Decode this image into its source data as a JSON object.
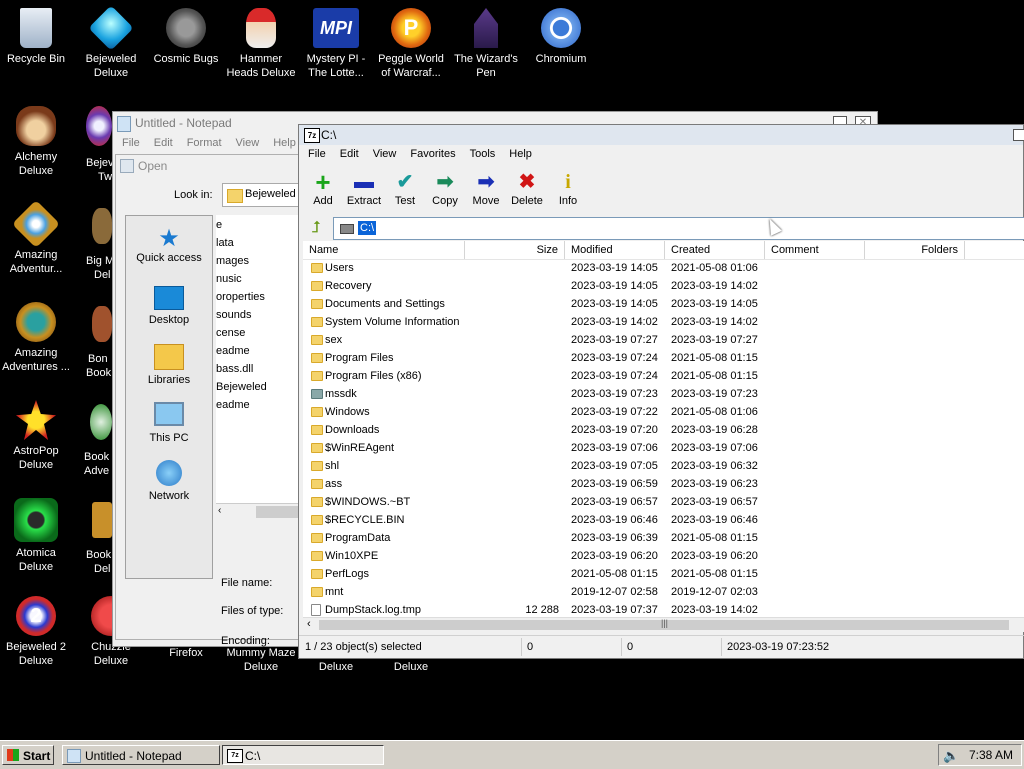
{
  "desktop": {
    "icons": [
      {
        "label": "Recycle Bin",
        "icon": "recycle-bin-icon"
      },
      {
        "label": "Bejeweled Deluxe",
        "icon": "bejeweled-icon"
      },
      {
        "label": "Cosmic Bugs",
        "icon": "cosmic-bugs-icon"
      },
      {
        "label": "Hammer Heads Deluxe",
        "icon": "hammer-heads-icon"
      },
      {
        "label": "Mystery PI - The Lotte...",
        "icon": "mystery-pi-icon"
      },
      {
        "label": "Peggle World of Warcraf...",
        "icon": "peggle-icon"
      },
      {
        "label": "The Wizard's Pen",
        "icon": "wizards-pen-icon"
      },
      {
        "label": "Chromium",
        "icon": "chromium-icon"
      },
      {
        "label": "Alchemy Deluxe",
        "icon": "alchemy-icon"
      },
      {
        "label": "Amazing Adventur...",
        "icon": "amazing-adventures-icon"
      },
      {
        "label": "Amazing Adventures ...",
        "icon": "amazing-adventures-2-icon"
      },
      {
        "label": "AstroPop Deluxe",
        "icon": "astropop-icon"
      },
      {
        "label": "Atomica Deluxe",
        "icon": "atomica-icon"
      },
      {
        "label": "Bejeweled 2 Deluxe",
        "icon": "bejeweled-2-icon"
      },
      {
        "label": "Chuzzle Deluxe",
        "icon": "chuzzle-icon"
      },
      {
        "label": "Firefox",
        "icon": "firefox-icon"
      },
      {
        "label": "Mummy Maze Deluxe",
        "icon": "mummy-maze-icon"
      },
      {
        "label": "Deluxe",
        "icon": "generic-game-icon"
      },
      {
        "label": "Deluxe",
        "icon": "generic-game-2-icon"
      }
    ],
    "partial_labels": [
      "Bejev",
      "Tw",
      "Big M",
      "Del",
      "Bon",
      "Book",
      "Book",
      "Adve",
      "Book",
      "Del"
    ]
  },
  "notepad": {
    "title": "Untitled - Notepad",
    "menu": [
      "File",
      "Edit",
      "Format",
      "View",
      "Help"
    ]
  },
  "open_dialog": {
    "title": "Open",
    "look_in_label": "Look in:",
    "look_in_value": "Bejeweled",
    "places": [
      "Quick access",
      "Desktop",
      "Libraries",
      "This PC",
      "Network"
    ],
    "files": [
      "e",
      "lata",
      "mages",
      "nusic",
      "oroperties",
      "sounds",
      "cense",
      "eadme",
      "bass.dll",
      "Bejeweled",
      "eadme"
    ],
    "file_name_label": "File name:",
    "files_of_type_label": "Files of type:",
    "encoding_label": "Encoding:"
  },
  "sevenzip": {
    "title": "C:\\",
    "app_badge": "7z",
    "menu": [
      "File",
      "Edit",
      "View",
      "Favorites",
      "Tools",
      "Help"
    ],
    "toolbar": [
      {
        "label": "Add",
        "icon": "add-icon",
        "glyph": "+",
        "color": "#1aa51a"
      },
      {
        "label": "Extract",
        "icon": "extract-icon",
        "glyph": "▬",
        "color": "#1a2fb5"
      },
      {
        "label": "Test",
        "icon": "test-icon",
        "glyph": "✔",
        "color": "#1a9a9a"
      },
      {
        "label": "Copy",
        "icon": "copy-icon",
        "glyph": "➡",
        "color": "#1a8a5a"
      },
      {
        "label": "Move",
        "icon": "move-icon",
        "glyph": "➡",
        "color": "#1a2fb5"
      },
      {
        "label": "Delete",
        "icon": "delete-icon",
        "glyph": "✖",
        "color": "#d01515"
      },
      {
        "label": "Info",
        "icon": "info-icon",
        "glyph": "i",
        "color": "#c8a800"
      }
    ],
    "address": "C:\\",
    "columns": [
      "Name",
      "Size",
      "Modified",
      "Created",
      "Comment",
      "Folders"
    ],
    "rows": [
      {
        "name": "Users",
        "size": "",
        "modified": "2023-03-19 14:05",
        "created": "2021-05-08 01:06",
        "type": "folder"
      },
      {
        "name": "Recovery",
        "size": "",
        "modified": "2023-03-19 14:05",
        "created": "2023-03-19 14:02",
        "type": "folder"
      },
      {
        "name": "Documents and Settings",
        "size": "",
        "modified": "2023-03-19 14:05",
        "created": "2023-03-19 14:05",
        "type": "folder"
      },
      {
        "name": "System Volume Information",
        "size": "",
        "modified": "2023-03-19 14:02",
        "created": "2023-03-19 14:02",
        "type": "folder"
      },
      {
        "name": "sex",
        "size": "",
        "modified": "2023-03-19 07:27",
        "created": "2023-03-19 07:27",
        "type": "folder"
      },
      {
        "name": "Program Files",
        "size": "",
        "modified": "2023-03-19 07:24",
        "created": "2021-05-08 01:15",
        "type": "folder"
      },
      {
        "name": "Program Files (x86)",
        "size": "",
        "modified": "2023-03-19 07:24",
        "created": "2021-05-08 01:15",
        "type": "folder"
      },
      {
        "name": "mssdk",
        "size": "",
        "modified": "2023-03-19 07:23",
        "created": "2023-03-19 07:23",
        "type": "selected"
      },
      {
        "name": "Windows",
        "size": "",
        "modified": "2023-03-19 07:22",
        "created": "2021-05-08 01:06",
        "type": "folder"
      },
      {
        "name": "Downloads",
        "size": "",
        "modified": "2023-03-19 07:20",
        "created": "2023-03-19 06:28",
        "type": "folder"
      },
      {
        "name": "$WinREAgent",
        "size": "",
        "modified": "2023-03-19 07:06",
        "created": "2023-03-19 07:06",
        "type": "folder"
      },
      {
        "name": "shl",
        "size": "",
        "modified": "2023-03-19 07:05",
        "created": "2023-03-19 06:32",
        "type": "folder"
      },
      {
        "name": "ass",
        "size": "",
        "modified": "2023-03-19 06:59",
        "created": "2023-03-19 06:23",
        "type": "folder"
      },
      {
        "name": "$WINDOWS.~BT",
        "size": "",
        "modified": "2023-03-19 06:57",
        "created": "2023-03-19 06:57",
        "type": "folder"
      },
      {
        "name": "$RECYCLE.BIN",
        "size": "",
        "modified": "2023-03-19 06:46",
        "created": "2023-03-19 06:46",
        "type": "folder"
      },
      {
        "name": "ProgramData",
        "size": "",
        "modified": "2023-03-19 06:39",
        "created": "2021-05-08 01:15",
        "type": "folder"
      },
      {
        "name": "Win10XPE",
        "size": "",
        "modified": "2023-03-19 06:20",
        "created": "2023-03-19 06:20",
        "type": "folder"
      },
      {
        "name": "PerfLogs",
        "size": "",
        "modified": "2021-05-08 01:15",
        "created": "2021-05-08 01:15",
        "type": "folder"
      },
      {
        "name": "mnt",
        "size": "",
        "modified": "2019-12-07 02:58",
        "created": "2019-12-07 02:03",
        "type": "folder"
      },
      {
        "name": "DumpStack.log.tmp",
        "size": "12 288",
        "modified": "2023-03-19 07:37",
        "created": "2023-03-19 14:02",
        "type": "file"
      }
    ],
    "status": {
      "selected": "1 / 23 object(s) selected",
      "size": "0",
      "packed": "0",
      "date": "2023-03-19 07:23:52"
    }
  },
  "taskbar": {
    "start_label": "Start",
    "tasks": [
      {
        "label": "Untitled - Notepad",
        "icon": "notepad-icon"
      },
      {
        "label": "C:\\",
        "icon": "sevenzip-icon",
        "badge": "7z"
      }
    ],
    "clock": "7:38 AM"
  }
}
